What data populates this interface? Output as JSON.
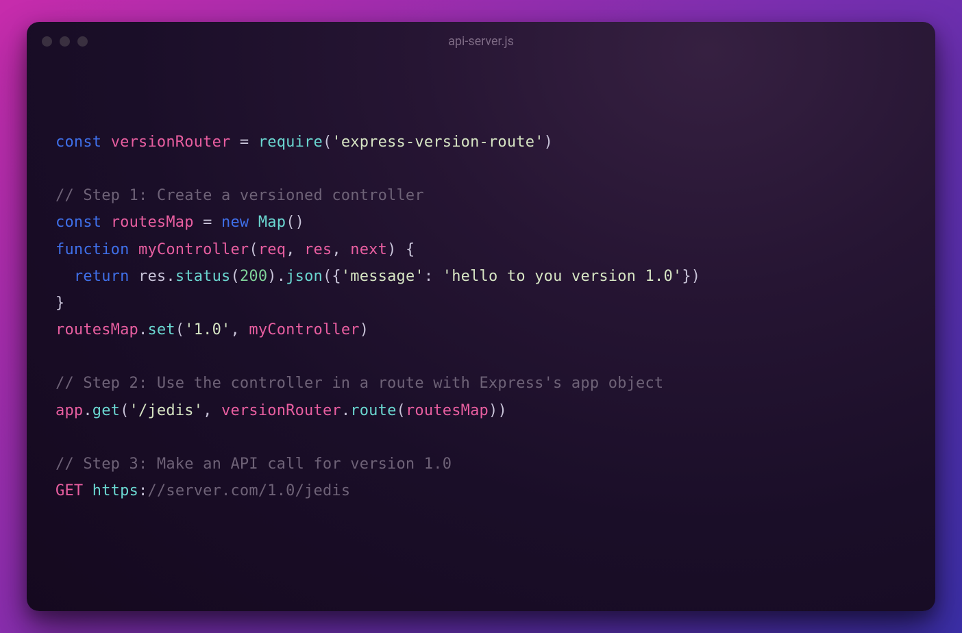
{
  "title": "api-server.js",
  "code": {
    "l1_const": "const",
    "l1_var": "versionRouter",
    "l1_eq": " = ",
    "l1_req": "require",
    "l1_open": "(",
    "l1_str": "'express-version-route'",
    "l1_close": ")",
    "l3_cm": "// Step 1: Create a versioned controller",
    "l4_const": "const",
    "l4_var": "routesMap",
    "l4_eq": " = ",
    "l4_new": "new",
    "l4_map": "Map",
    "l4_par": "()",
    "l5_fn": "function",
    "l5_name": "myController",
    "l5_open": "(",
    "l5_p1": "req",
    "l5_c1": ", ",
    "l5_p2": "res",
    "l5_c2": ", ",
    "l5_p3": "next",
    "l5_close": ") {",
    "l6_indent": "  ",
    "l6_return": "return",
    "l6_sp": " ",
    "l6_res": "res",
    "l6_d1": ".",
    "l6_status": "status",
    "l6_op1": "(",
    "l6_200": "200",
    "l6_cp1": ")",
    "l6_d2": ".",
    "l6_json": "json",
    "l6_op2": "({",
    "l6_key": "'message'",
    "l6_colon": ": ",
    "l6_val": "'hello to you version 1.0'",
    "l6_cp2": "})",
    "l7_close": "}",
    "l8_obj": "routesMap",
    "l8_d": ".",
    "l8_set": "set",
    "l8_open": "(",
    "l8_str": "'1.0'",
    "l8_c": ", ",
    "l8_ctrl": "myController",
    "l8_close": ")",
    "l10_cm": "// Step 2: Use the controller in a route with Express's app object",
    "l11_app": "app",
    "l11_d1": ".",
    "l11_get": "get",
    "l11_open": "(",
    "l11_str": "'/jedis'",
    "l11_c": ", ",
    "l11_vr": "versionRouter",
    "l11_d2": ".",
    "l11_route": "route",
    "l11_op2": "(",
    "l11_rm": "routesMap",
    "l11_cp2": ")",
    "l11_close": ")",
    "l13_cm": "// Step 3: Make an API call for version 1.0",
    "l14_get": "GET",
    "l14_sp": " ",
    "l14_https": "https",
    "l14_colon": ":",
    "l14_rest": "//server.com/1.0/jedis"
  }
}
